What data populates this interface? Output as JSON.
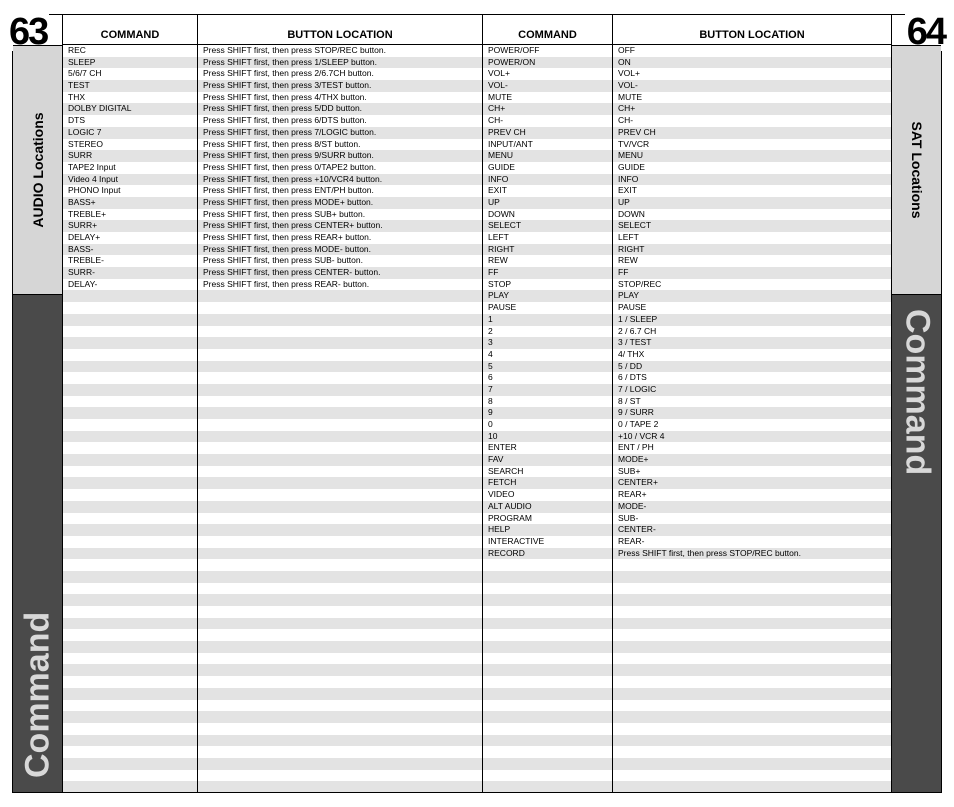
{
  "page_left_num": "63",
  "page_right_num": "64",
  "left_section_label": "AUDIO Locations",
  "right_section_label": "SAT Locations",
  "band_label": "Command",
  "headers": {
    "command": "COMMAND",
    "button_location": "BUTTON LOCATION"
  },
  "row_count": 64,
  "left_table": [
    {
      "command": "REC",
      "button": "Press SHIFT first, then press STOP/REC button."
    },
    {
      "command": "SLEEP",
      "button": "Press SHIFT first, then press 1/SLEEP button."
    },
    {
      "command": "5/6/7 CH",
      "button": "Press SHIFT first, then press 2/6.7CH button."
    },
    {
      "command": "TEST",
      "button": "Press SHIFT first, then press 3/TEST button."
    },
    {
      "command": "THX",
      "button": "Press SHIFT first, then press 4/THX button."
    },
    {
      "command": "DOLBY DIGITAL",
      "button": "Press SHIFT first, then press 5/DD button."
    },
    {
      "command": "DTS",
      "button": "Press SHIFT first, then press 6/DTS button."
    },
    {
      "command": "LOGIC 7",
      "button": "Press SHIFT first, then press 7/LOGIC button."
    },
    {
      "command": "STEREO",
      "button": "Press SHIFT first, then press 8/ST button."
    },
    {
      "command": "SURR",
      "button": "Press SHIFT first, then press 9/SURR button."
    },
    {
      "command": "TAPE2 Input",
      "button": "Press SHIFT first, then press 0/TAPE2 button."
    },
    {
      "command": "Video 4 Input",
      "button": "Press SHIFT first, then press +10/VCR4 button."
    },
    {
      "command": "PHONO Input",
      "button": "Press SHIFT first, then press ENT/PH button."
    },
    {
      "command": "BASS+",
      "button": "Press SHIFT first, then press MODE+ button."
    },
    {
      "command": "TREBLE+",
      "button": "Press SHIFT first, then press SUB+ button."
    },
    {
      "command": "SURR+",
      "button": "Press SHIFT first, then press CENTER+ button."
    },
    {
      "command": "DELAY+",
      "button": "Press SHIFT first, then press REAR+ button."
    },
    {
      "command": "BASS-",
      "button": "Press SHIFT first, then press MODE- button."
    },
    {
      "command": "TREBLE-",
      "button": "Press SHIFT first, then press SUB- button."
    },
    {
      "command": "SURR-",
      "button": "Press SHIFT first, then press CENTER- button."
    },
    {
      "command": "DELAY-",
      "button": "Press SHIFT first, then press REAR- button."
    }
  ],
  "right_table": [
    {
      "command": "POWER/OFF",
      "button": "OFF"
    },
    {
      "command": "POWER/ON",
      "button": "ON"
    },
    {
      "command": "VOL+",
      "button": "VOL+"
    },
    {
      "command": "VOL-",
      "button": "VOL-"
    },
    {
      "command": "MUTE",
      "button": "MUTE"
    },
    {
      "command": "CH+",
      "button": "CH+"
    },
    {
      "command": "CH-",
      "button": "CH-"
    },
    {
      "command": "PREV CH",
      "button": "PREV CH"
    },
    {
      "command": "INPUT/ANT",
      "button": "TV/VCR"
    },
    {
      "command": "MENU",
      "button": "MENU"
    },
    {
      "command": "GUIDE",
      "button": "GUIDE"
    },
    {
      "command": "INFO",
      "button": "INFO"
    },
    {
      "command": "EXIT",
      "button": "EXIT"
    },
    {
      "command": "UP",
      "button": "UP"
    },
    {
      "command": "DOWN",
      "button": "DOWN"
    },
    {
      "command": "SELECT",
      "button": "SELECT"
    },
    {
      "command": "LEFT",
      "button": "LEFT"
    },
    {
      "command": "RIGHT",
      "button": "RIGHT"
    },
    {
      "command": "REW",
      "button": "REW"
    },
    {
      "command": "FF",
      "button": "FF"
    },
    {
      "command": "STOP",
      "button": "STOP/REC"
    },
    {
      "command": "PLAY",
      "button": "PLAY"
    },
    {
      "command": "PAUSE",
      "button": "PAUSE"
    },
    {
      "command": "1",
      "button": "1 / SLEEP"
    },
    {
      "command": "2",
      "button": "2 / 6.7 CH"
    },
    {
      "command": "3",
      "button": "3 / TEST"
    },
    {
      "command": "4",
      "button": "4/ THX"
    },
    {
      "command": "5",
      "button": "5 / DD"
    },
    {
      "command": "6",
      "button": "6 / DTS"
    },
    {
      "command": "7",
      "button": "7 / LOGIC"
    },
    {
      "command": "8",
      "button": "8 / ST"
    },
    {
      "command": "9",
      "button": "9 / SURR"
    },
    {
      "command": "0",
      "button": "0 / TAPE 2"
    },
    {
      "command": "10",
      "button": "+10 / VCR 4"
    },
    {
      "command": "ENTER",
      "button": "ENT / PH"
    },
    {
      "command": "FAV",
      "button": "MODE+"
    },
    {
      "command": "SEARCH",
      "button": "SUB+"
    },
    {
      "command": "FETCH",
      "button": "CENTER+"
    },
    {
      "command": "VIDEO",
      "button": "REAR+"
    },
    {
      "command": "ALT AUDIO",
      "button": "MODE-"
    },
    {
      "command": "PROGRAM",
      "button": "SUB-"
    },
    {
      "command": "HELP",
      "button": "CENTER-"
    },
    {
      "command": "INTERACTIVE",
      "button": "REAR-"
    },
    {
      "command": "RECORD",
      "button": "Press SHIFT first, then press STOP/REC button."
    }
  ]
}
